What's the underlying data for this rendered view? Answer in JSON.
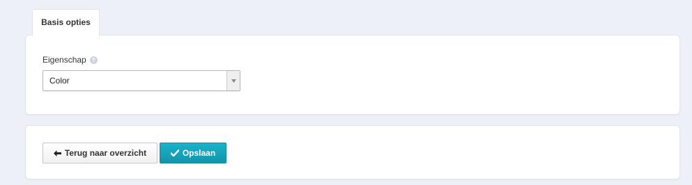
{
  "tabs": [
    {
      "label": "Basis opties",
      "active": true
    }
  ],
  "options": {
    "property_label": "Eigenschap",
    "help_glyph": "?",
    "property_select": {
      "value": "Color"
    }
  },
  "actions": {
    "back_label": "Terug naar overzicht",
    "save_label": "Opslaan"
  },
  "icons": {
    "back": "arrow-left-icon",
    "save": "checkmark-icon",
    "select": "caret-down-icon",
    "help": "help-icon"
  },
  "colors": {
    "page_background": "#edf0f7",
    "panel_background": "#ffffff",
    "save_button": "#17a2b8",
    "text": "#333333"
  }
}
